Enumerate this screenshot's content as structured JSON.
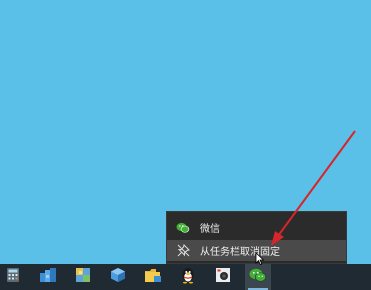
{
  "jump_list": {
    "items": [
      {
        "label": "微信",
        "icon": "wechat-icon"
      },
      {
        "label": "从任务栏取消固定",
        "icon": "unpin-icon"
      }
    ]
  },
  "taskbar": {
    "apps": [
      {
        "name": "calculator-icon"
      },
      {
        "name": "app-blue-blocks-icon"
      },
      {
        "name": "app-yellow-grid-icon"
      },
      {
        "name": "app-blue-cube-icon"
      },
      {
        "name": "file-explorer-icon"
      },
      {
        "name": "qq-penguin-icon"
      },
      {
        "name": "camera-app-icon"
      },
      {
        "name": "wechat-icon",
        "active": true
      }
    ]
  },
  "colors": {
    "desktop": "#5bc0e8",
    "menu_bg": "#2b2b2b",
    "menu_hover": "#4a4a4a",
    "taskbar": "#1f2a33",
    "arrow": "#d6252b"
  }
}
